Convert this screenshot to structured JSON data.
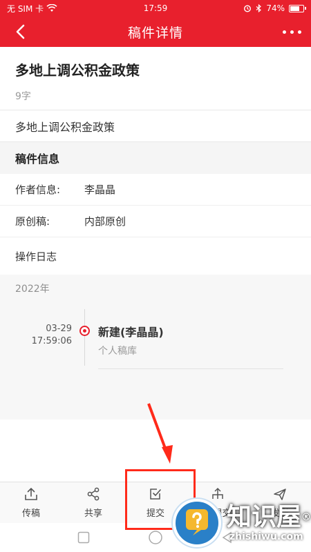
{
  "status_bar": {
    "carrier": "无 SIM 卡",
    "time": "17:59",
    "battery": "74%",
    "battery_level": 0.74
  },
  "nav": {
    "title": "稿件详情",
    "back_icon": "chevron-left-icon",
    "more_icon": "more-dots-icon"
  },
  "article": {
    "title": "多地上调公积金政策",
    "word_count": "9字",
    "summary": "多地上调公积金政策"
  },
  "info": {
    "section_title": "稿件信息",
    "author_label": "作者信息:",
    "author_value": "李晶晶",
    "original_label": "原创稿:",
    "original_value": "内部原创"
  },
  "log": {
    "title": "操作日志",
    "year": "2022年",
    "entries": [
      {
        "date": "03-29",
        "time": "17:59:06",
        "action": "新建(李晶晶)",
        "detail": "个人稿库"
      }
    ]
  },
  "tabs": [
    {
      "label": "传稿",
      "icon": "upload-icon"
    },
    {
      "label": "共享",
      "icon": "share-icon"
    },
    {
      "label": "提交",
      "icon": "submit-check-icon"
    },
    {
      "label": "门提交",
      "icon": "branch-submit-icon"
    },
    {
      "label": "发送",
      "icon": "send-icon"
    }
  ],
  "colors": {
    "brand": "#e8202d",
    "annotation": "#ff2a1a",
    "watermark": "#2a80c8"
  },
  "watermark": {
    "brand_cn": "知识屋",
    "brand_mark": "®",
    "brand_en": "zhishiwu.com"
  }
}
